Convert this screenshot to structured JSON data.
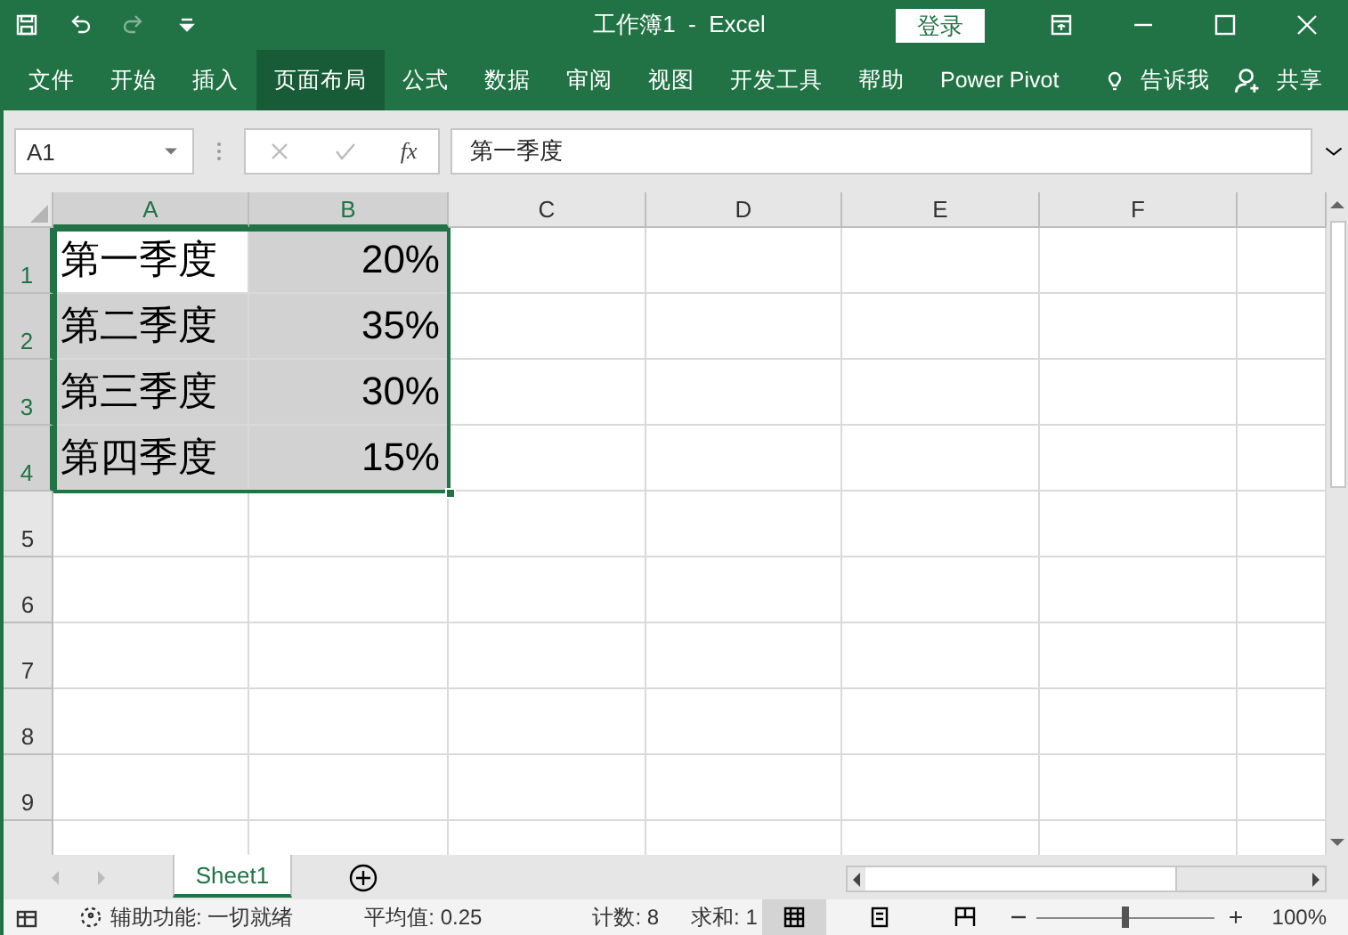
{
  "title_bar": {
    "title": "工作簿1  -  Excel",
    "login_button": "登录"
  },
  "ribbon_tabs": [
    {
      "label": "文件",
      "hovered": false
    },
    {
      "label": "开始",
      "hovered": false
    },
    {
      "label": "插入",
      "hovered": false
    },
    {
      "label": "页面布局",
      "hovered": true
    },
    {
      "label": "公式",
      "hovered": false
    },
    {
      "label": "数据",
      "hovered": false
    },
    {
      "label": "审阅",
      "hovered": false
    },
    {
      "label": "视图",
      "hovered": false
    },
    {
      "label": "开发工具",
      "hovered": false
    },
    {
      "label": "帮助",
      "hovered": false
    },
    {
      "label": "Power Pivot",
      "hovered": false
    }
  ],
  "tell_me": "告诉我",
  "share": "共享",
  "formula_bar": {
    "name_box": "A1",
    "function_button": "fx",
    "value": "第一季度"
  },
  "columns": [
    {
      "label": "A",
      "selected": true
    },
    {
      "label": "B",
      "selected": true
    },
    {
      "label": "C",
      "selected": false
    },
    {
      "label": "D",
      "selected": false
    },
    {
      "label": "E",
      "selected": false
    },
    {
      "label": "F",
      "selected": false
    }
  ],
  "rows": [
    {
      "label": "1",
      "selected": true,
      "cells": [
        {
          "text": "第一季度",
          "active": true
        },
        {
          "text": "20%",
          "selected": true,
          "active": false
        }
      ]
    },
    {
      "label": "2",
      "selected": true,
      "cells": [
        {
          "text": "第二季度",
          "selected": true,
          "active": false
        },
        {
          "text": "35%",
          "selected": true,
          "active": false
        }
      ]
    },
    {
      "label": "3",
      "selected": true,
      "cells": [
        {
          "text": "第三季度",
          "selected": true,
          "active": false
        },
        {
          "text": "30%",
          "selected": true,
          "active": false
        }
      ]
    },
    {
      "label": "4",
      "selected": true,
      "cells": [
        {
          "text": "第四季度",
          "selected": true,
          "active": false
        },
        {
          "text": "15%",
          "selected": true,
          "active": false
        }
      ]
    },
    {
      "label": "5",
      "selected": false
    },
    {
      "label": "6",
      "selected": false
    },
    {
      "label": "7",
      "selected": false
    },
    {
      "label": "8",
      "selected": false
    },
    {
      "label": "9",
      "selected": false
    }
  ],
  "sheet_tabs": [
    {
      "label": "Sheet1",
      "selected": true
    }
  ],
  "status_bar": {
    "accessibility": "辅助功能: 一切就绪",
    "average": "平均值: 0.25",
    "count": "计数: 8",
    "sum": "求和: 1",
    "views": [
      {
        "kind": "normal",
        "selected": true
      },
      {
        "kind": "page-layout",
        "selected": false
      },
      {
        "kind": "page-break",
        "selected": false
      }
    ],
    "zoom": {
      "level": 0.5,
      "reading": "100%"
    }
  }
}
